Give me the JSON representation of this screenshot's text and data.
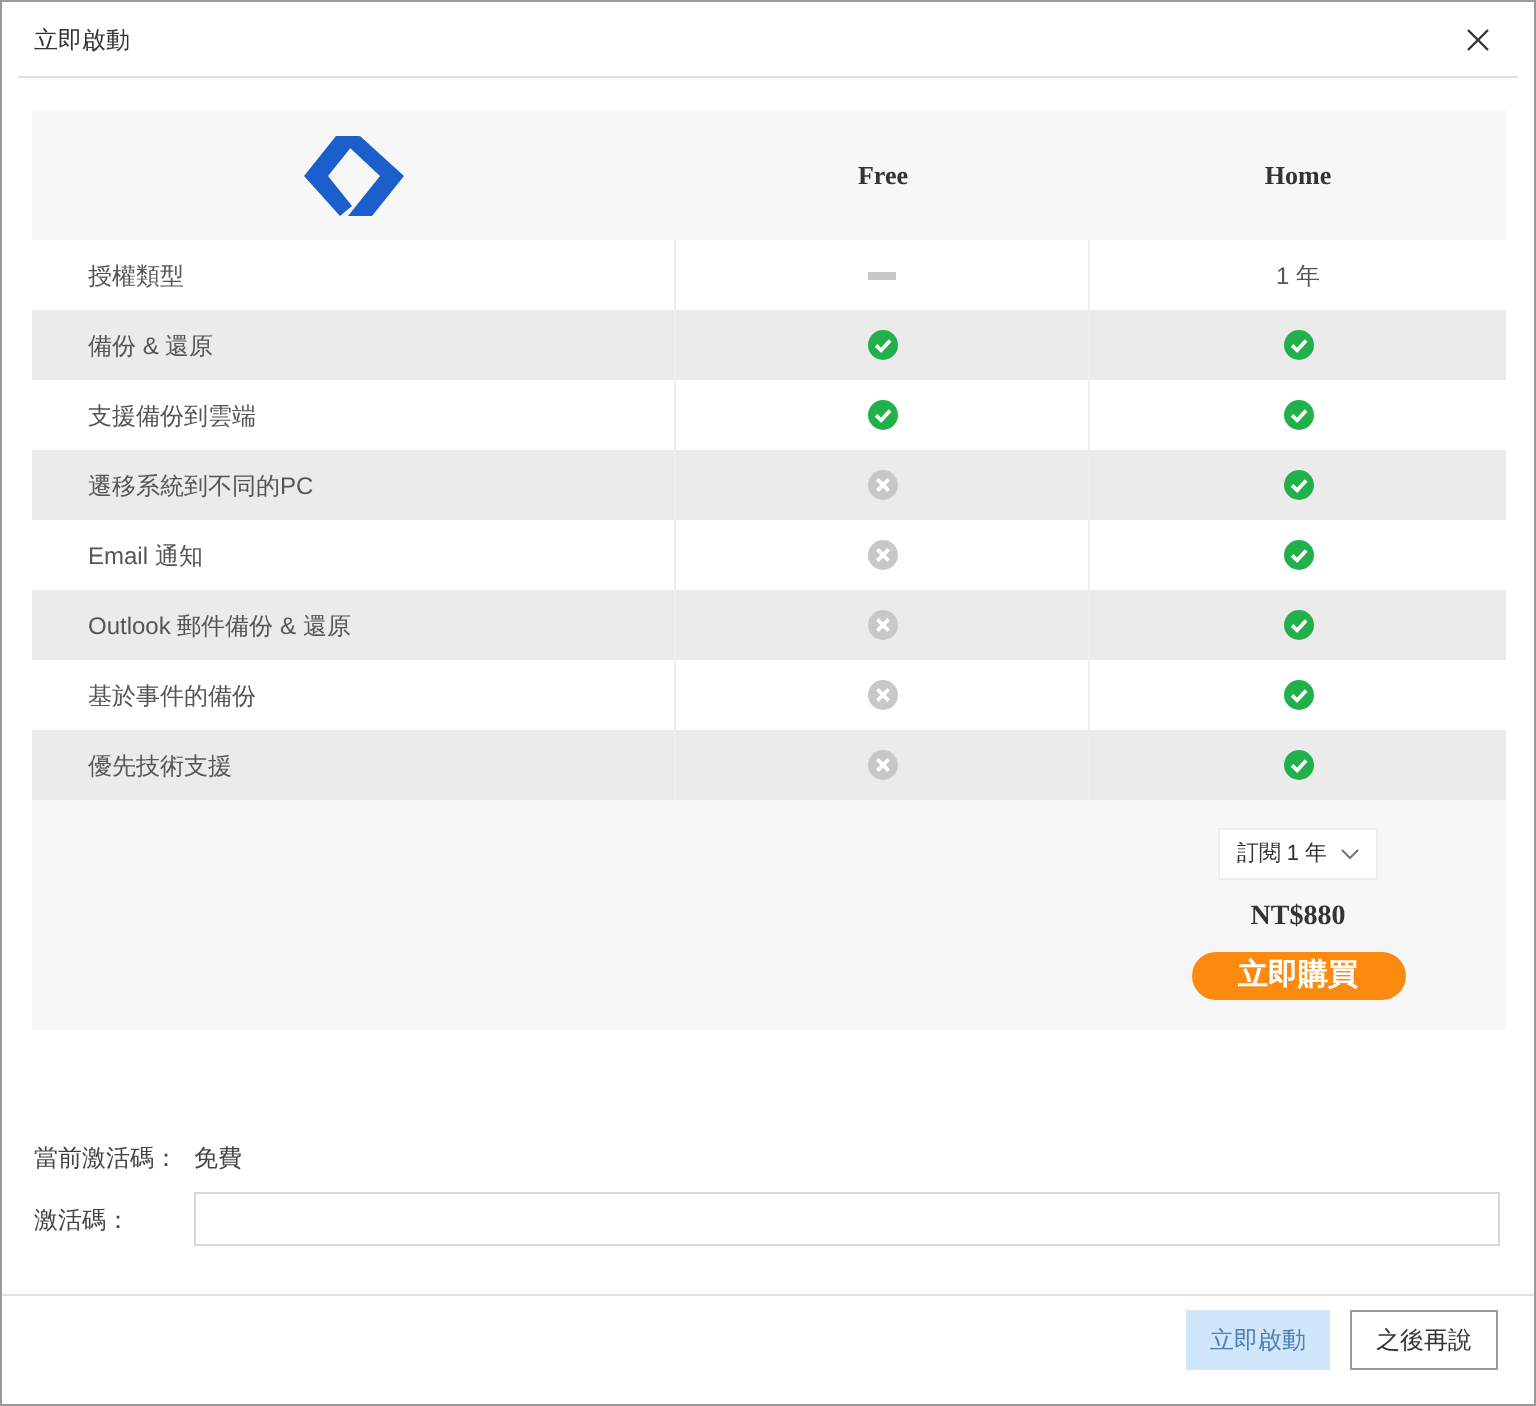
{
  "window": {
    "title": "立即啟動"
  },
  "table": {
    "columns": [
      "Free",
      "Home"
    ],
    "rows": [
      {
        "label": "授權類型",
        "cells": [
          {
            "kind": "dash"
          },
          {
            "kind": "text",
            "text": "1 年"
          }
        ]
      },
      {
        "label": "備份 & 還原",
        "cells": [
          {
            "kind": "check"
          },
          {
            "kind": "check"
          }
        ]
      },
      {
        "label": "支援備份到雲端",
        "cells": [
          {
            "kind": "check"
          },
          {
            "kind": "check"
          }
        ]
      },
      {
        "label": "遷移系統到不同的PC",
        "cells": [
          {
            "kind": "cross"
          },
          {
            "kind": "check"
          }
        ]
      },
      {
        "label": "Email 通知",
        "cells": [
          {
            "kind": "cross"
          },
          {
            "kind": "check"
          }
        ]
      },
      {
        "label": "Outlook 郵件備份 & 還原",
        "cells": [
          {
            "kind": "cross"
          },
          {
            "kind": "check"
          }
        ]
      },
      {
        "label": "基於事件的備份",
        "cells": [
          {
            "kind": "cross"
          },
          {
            "kind": "check"
          }
        ]
      },
      {
        "label": "優先技術支援",
        "cells": [
          {
            "kind": "cross"
          },
          {
            "kind": "check"
          }
        ]
      }
    ],
    "plan_select": {
      "value": "訂閱 1 年"
    },
    "price": "NT$880",
    "buy_button": "立即購買"
  },
  "current_code": {
    "label": "當前激活碼：",
    "value": "免費"
  },
  "code_field": {
    "label": "激活碼："
  },
  "buttons": [
    {
      "label": "立即啟動",
      "disabled": true
    },
    {
      "label": "之後再說",
      "disabled": false
    }
  ]
}
